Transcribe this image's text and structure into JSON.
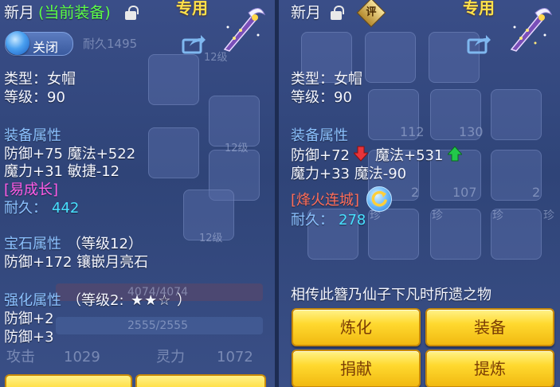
{
  "left": {
    "name": "新月",
    "equipped_tag": "(当前装备)",
    "exclusive_label": "专用",
    "toggle_label": "关闭",
    "type_line": "类型：女帽",
    "level_line": "等级：90",
    "equip_attr_title": "装备属性",
    "attr_line1": "防御+75 魔法+522",
    "attr_line2": "魔力+31 敏捷-12",
    "special_tag": "[易成长]",
    "durability_label": "耐久：",
    "durability_value": "442",
    "gem_title": "宝石属性",
    "gem_level": "（等级12）",
    "gem_line": "防御+172 镶嵌月亮石",
    "enhance_title": "强化属性",
    "enhance_level": "（等级2:",
    "enhance_stars": "★★☆",
    "enhance_close": "）",
    "enhance_line1": "防御+2",
    "enhance_line2": "防御+3",
    "background": {
      "durability_hint": "耐久1495",
      "slot_level_a": "12级",
      "slot_level_b": "12级",
      "slot_level_c": "12级",
      "hp_bar": "4074/4074",
      "mp_bar": "2555/2555",
      "attack_label": "攻击",
      "attack_value": "1029",
      "spirit_label": "灵力",
      "spirit_value": "1072"
    }
  },
  "right": {
    "name": "新月",
    "exclusive_label": "专用",
    "eval_badge": "评",
    "type_line": "类型：女帽",
    "level_line": "等级：90",
    "equip_attr_title": "装备属性",
    "attr_def": "防御+72",
    "attr_magic": "魔法+531",
    "attr_line2": "魔力+33 魔法-90",
    "special_tag": "[烽火连城]",
    "durability_label": "耐久：",
    "durability_value": "278",
    "description": "相传此簪乃仙子下凡时所遗之物",
    "buttons": {
      "refine": "炼化",
      "equip": "装备",
      "donate": "捐献",
      "extract": "提炼"
    },
    "background": {
      "count_a": "112",
      "count_b": "130",
      "count_c": "2",
      "count_d": "107",
      "count_e": "2",
      "rare_a": "珍",
      "rare_b": "珍",
      "rare_c": "珍",
      "rare_d": "珍"
    }
  },
  "colors": {
    "attr_title": "#8cc2ff",
    "durability_value": "#48e0ff",
    "special_left": "#ff5ce6",
    "special_right": "#ff6e5a",
    "equipped_tag": "#5dff48",
    "exclusive": "#ffe24a",
    "stat_down": "#e8343a",
    "stat_up": "#22c84a"
  }
}
